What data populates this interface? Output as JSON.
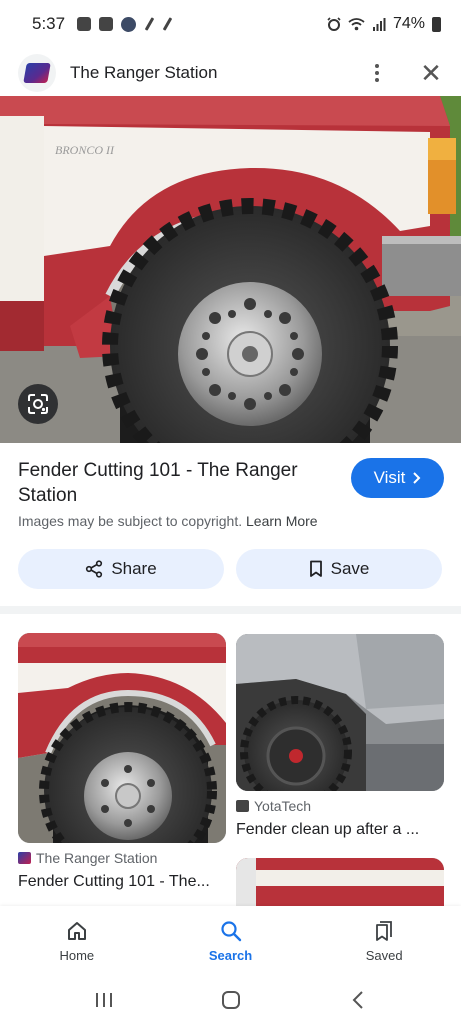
{
  "status_bar": {
    "time": "5:37",
    "battery": "74%"
  },
  "header": {
    "site_name": "The Ranger Station",
    "more_icon": "more-vert-icon",
    "close_icon": "close-icon"
  },
  "result": {
    "title": "Fender Cutting 101 - The Ranger Station",
    "visit_label": "Visit",
    "copyright_text": "Images may be subject to copyright.",
    "learn_more": "Learn More",
    "share_label": "Share",
    "save_label": "Save"
  },
  "related": [
    {
      "source": "The Ranger Station",
      "title": "Fender Cutting 101 - The..."
    },
    {
      "source": "YotaTech",
      "title": "Fender clean up after a ..."
    }
  ],
  "bottom_nav": [
    {
      "label": "Home",
      "icon": "home-icon"
    },
    {
      "label": "Search",
      "icon": "search-icon"
    },
    {
      "label": "Saved",
      "icon": "bookmarks-icon"
    }
  ],
  "colors": {
    "accent": "#1a73e8",
    "tonal_button": "#e8f0fe",
    "truck_red": "#b8323a"
  }
}
